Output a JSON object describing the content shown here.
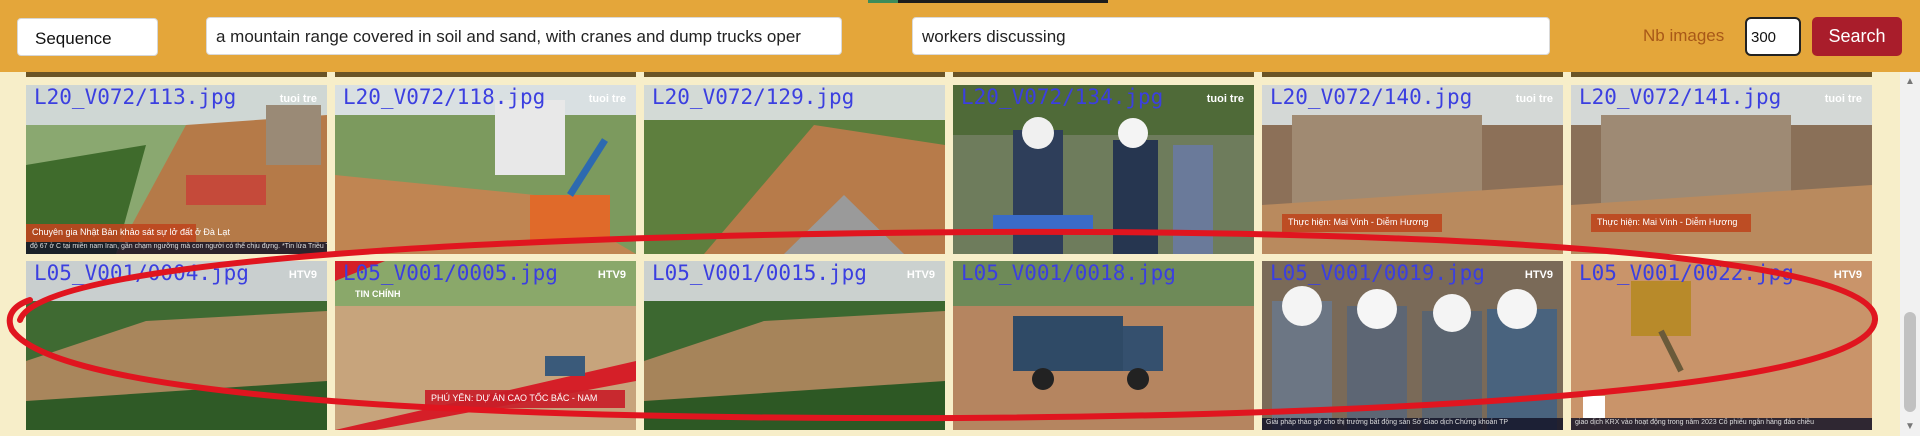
{
  "toolbar": {
    "mode_select": "Sequence",
    "query1": "a mountain range covered in soil and sand, with cranes and dump trucks oper",
    "query2": "workers discussing",
    "nb_images_label": "Nb images",
    "nb_images_value": "300",
    "search_label": "Search"
  },
  "results": {
    "row1": [
      {
        "file": "L20_V072/113.jpg",
        "logo": "tuoi tre",
        "caption": "Chuyên gia Nhật Bản khảo sát sự lở đất ở Đà Lạt",
        "ticker": "độ 67 ở C tại miền nam Iran, gần chạm ngưỡng mà con người có thể chịu đựng. *Tin lửa Triều Tiên bay xa 600km. Rạng sáng 19-7, giờ Việt Nam, quân đội Hàn Quốc cho hay Triều tiên đã phóng 2 tên lửa"
      },
      {
        "file": "L20_V072/118.jpg",
        "logo": "tuoi tre"
      },
      {
        "file": "L20_V072/129.jpg",
        "logo": ""
      },
      {
        "file": "L20_V072/134.jpg",
        "logo": "tuoi tre"
      },
      {
        "file": "L20_V072/140.jpg",
        "logo": "tuoi tre",
        "caption": "Thực hiện: Mai Vinh - Diễm Hương"
      },
      {
        "file": "L20_V072/141.jpg",
        "logo": "tuoi tre",
        "caption": "Thực hiện: Mai Vinh - Diễm Hương"
      }
    ],
    "row2": [
      {
        "file": "L05_V001/0004.jpg",
        "logo": "HTV9"
      },
      {
        "file": "L05_V001/0005.jpg",
        "logo": "HTV9",
        "caption": "PHÚ YÊN: DỰ ÁN CAO TỐC BẮC - NAM",
        "tag": "TIN CHÍNH"
      },
      {
        "file": "L05_V001/0015.jpg",
        "logo": "HTV9"
      },
      {
        "file": "L05_V001/0018.jpg",
        "logo": ""
      },
      {
        "file": "L05_V001/0019.jpg",
        "logo": "HTV9",
        "ticker": "Giải pháp thảo gỡ cho thị trường bất động sản    Sở Giao dịch Chứng khoán TP"
      },
      {
        "file": "L05_V001/0022.jpg",
        "logo": "HTV9",
        "ticker": "giao dịch KRX vào hoạt động trong năm 2023    Cổ phiếu ngân hàng đáo chiều"
      }
    ]
  },
  "colors": {
    "toolbar_bg": "#e4a63a",
    "search_button": "#a91d2b",
    "filename_text": "#3b3fe0",
    "annotation_ellipse": "#e0151f"
  }
}
